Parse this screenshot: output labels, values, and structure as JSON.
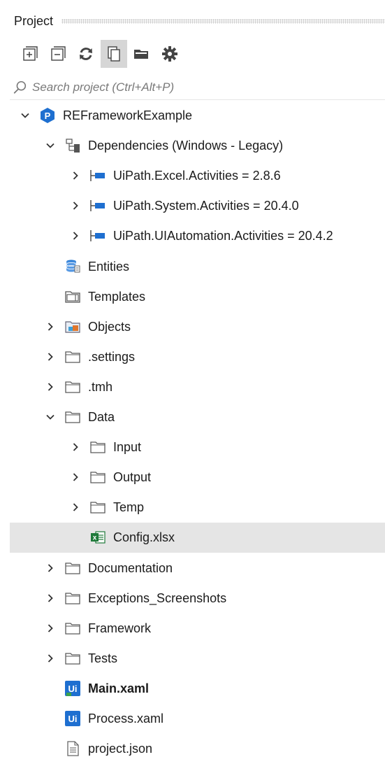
{
  "panel": {
    "title": "Project"
  },
  "toolbar": {
    "buttons": [
      {
        "icon": "expand-all-icon"
      },
      {
        "icon": "collapse-all-icon"
      },
      {
        "icon": "refresh-icon"
      },
      {
        "icon": "show-all-files-icon",
        "active": true
      },
      {
        "icon": "open-folder-icon"
      },
      {
        "icon": "settings-gear-icon"
      }
    ]
  },
  "search": {
    "placeholder": "Search project (Ctrl+Alt+P)"
  },
  "tree": {
    "items": [
      {
        "label": "REFrameworkExample",
        "level": 0,
        "chevron": "down",
        "icon": "project-badge-icon"
      },
      {
        "label": "Dependencies (Windows - Legacy)",
        "level": 1,
        "chevron": "down",
        "icon": "dependencies-icon"
      },
      {
        "label": "UiPath.Excel.Activities = 2.8.6",
        "level": 2,
        "chevron": "right",
        "icon": "package-icon"
      },
      {
        "label": "UiPath.System.Activities = 20.4.0",
        "level": 2,
        "chevron": "right",
        "icon": "package-icon"
      },
      {
        "label": "UiPath.UIAutomation.Activities = 20.4.2",
        "level": 2,
        "chevron": "right",
        "icon": "package-icon"
      },
      {
        "label": "Entities",
        "level": 1,
        "chevron": "none",
        "icon": "database-icon"
      },
      {
        "label": "Templates",
        "level": 1,
        "chevron": "none",
        "icon": "templates-folder-icon"
      },
      {
        "label": "Objects",
        "level": 1,
        "chevron": "right",
        "icon": "objects-icon"
      },
      {
        "label": ".settings",
        "level": 1,
        "chevron": "right",
        "icon": "folder-icon"
      },
      {
        "label": ".tmh",
        "level": 1,
        "chevron": "right",
        "icon": "folder-icon"
      },
      {
        "label": "Data",
        "level": 1,
        "chevron": "down",
        "icon": "folder-icon"
      },
      {
        "label": "Input",
        "level": 2,
        "chevron": "right",
        "icon": "folder-icon"
      },
      {
        "label": "Output",
        "level": 2,
        "chevron": "right",
        "icon": "folder-icon"
      },
      {
        "label": "Temp",
        "level": 2,
        "chevron": "right",
        "icon": "folder-icon"
      },
      {
        "label": "Config.xlsx",
        "level": 2,
        "chevron": "none",
        "icon": "excel-file-icon",
        "selected": true
      },
      {
        "label": "Documentation",
        "level": 1,
        "chevron": "right",
        "icon": "folder-icon"
      },
      {
        "label": "Exceptions_Screenshots",
        "level": 1,
        "chevron": "right",
        "icon": "folder-icon"
      },
      {
        "label": "Framework",
        "level": 1,
        "chevron": "right",
        "icon": "folder-icon"
      },
      {
        "label": "Tests",
        "level": 1,
        "chevron": "right",
        "icon": "folder-icon"
      },
      {
        "label": "Main.xaml",
        "level": 1,
        "chevron": "none",
        "icon": "main-xaml-icon",
        "bold": true
      },
      {
        "label": "Process.xaml",
        "level": 1,
        "chevron": "none",
        "icon": "xaml-icon"
      },
      {
        "label": "project.json",
        "level": 1,
        "chevron": "none",
        "icon": "json-file-icon"
      }
    ]
  },
  "colors": {
    "accent_blue": "#1e6fd0",
    "folder_stroke": "#5a5a5a",
    "excel_green": "#1f7a3a",
    "selected_row": "#e5e5e5"
  }
}
